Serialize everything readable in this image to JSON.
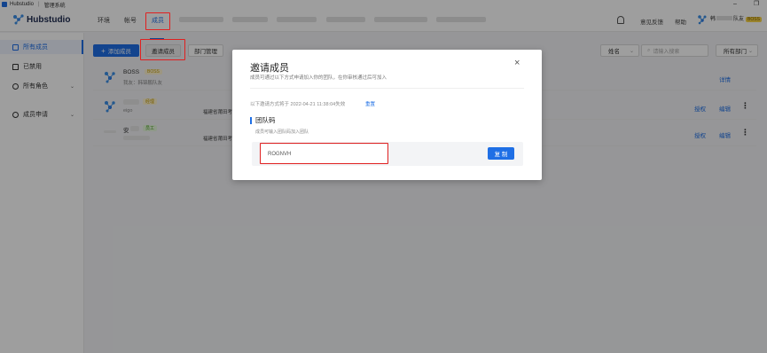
{
  "window": {
    "app_name": "Hubstudio",
    "title": "管理系统",
    "controls": [
      "–",
      "❐"
    ]
  },
  "nav": {
    "logo": "Hubstudio",
    "items": [
      {
        "label": "环境",
        "active": false
      },
      {
        "label": "帐号",
        "active": false
      },
      {
        "label": "成员",
        "active": true
      }
    ],
    "feedback": "意见反馈",
    "help": "帮助",
    "user_name_line1": "韩",
    "user_name_line2": "队友",
    "user_role": "BOSS"
  },
  "sidebar": {
    "items": [
      {
        "label": "所有成员",
        "active": true
      },
      {
        "label": "已禁用",
        "active": false
      },
      {
        "label": "所有角色",
        "active": false,
        "expand": "⌄"
      },
      {
        "label": "成员申请",
        "active": false,
        "expand": "⌄"
      }
    ]
  },
  "toolbar": {
    "add_member": "添加成员",
    "invite_member": "邀请成员",
    "dept_manage": "部门管理",
    "filter_select": "姓名",
    "search_placeholder": "请输入搜索",
    "dept_select": "所有部门"
  },
  "members": [
    {
      "name": "BOSS",
      "role_tag": "BOSS",
      "sub_prefix": "我友：",
      "sub_value": "韩锦鹏队友",
      "location": "",
      "actions": [
        "详情"
      ]
    },
    {
      "name": "",
      "role_tag": "经理",
      "sub_prefix": "",
      "sub_value": "eigo",
      "location": "福建省莆田考",
      "actions": [
        "授权",
        "编辑"
      ]
    },
    {
      "name": "安",
      "role_tag": "员工",
      "sub_prefix": "",
      "sub_value": "",
      "location": "福建省莆田考",
      "actions": [
        "授权",
        "编辑"
      ]
    }
  ],
  "modal": {
    "title": "邀请成员",
    "subtitle": "成员可通过以下方式申请加入你的团队，在你审核通过后可加入",
    "close": "×",
    "expire_text": "以下邀请方式将于 2022-04-21 11:38:04失效",
    "reset": "重置",
    "section_title": "团队码",
    "section_sub": "成员可输入团队码加入团队",
    "team_code": "ROGNVH",
    "copy": "复 制"
  },
  "colors": {
    "accent": "#1f6fe5",
    "highlight_box": "#e02020",
    "boss_tag": "#f7d348",
    "manager_tag": "#f7d348",
    "staff_tag": "#52c41a"
  }
}
